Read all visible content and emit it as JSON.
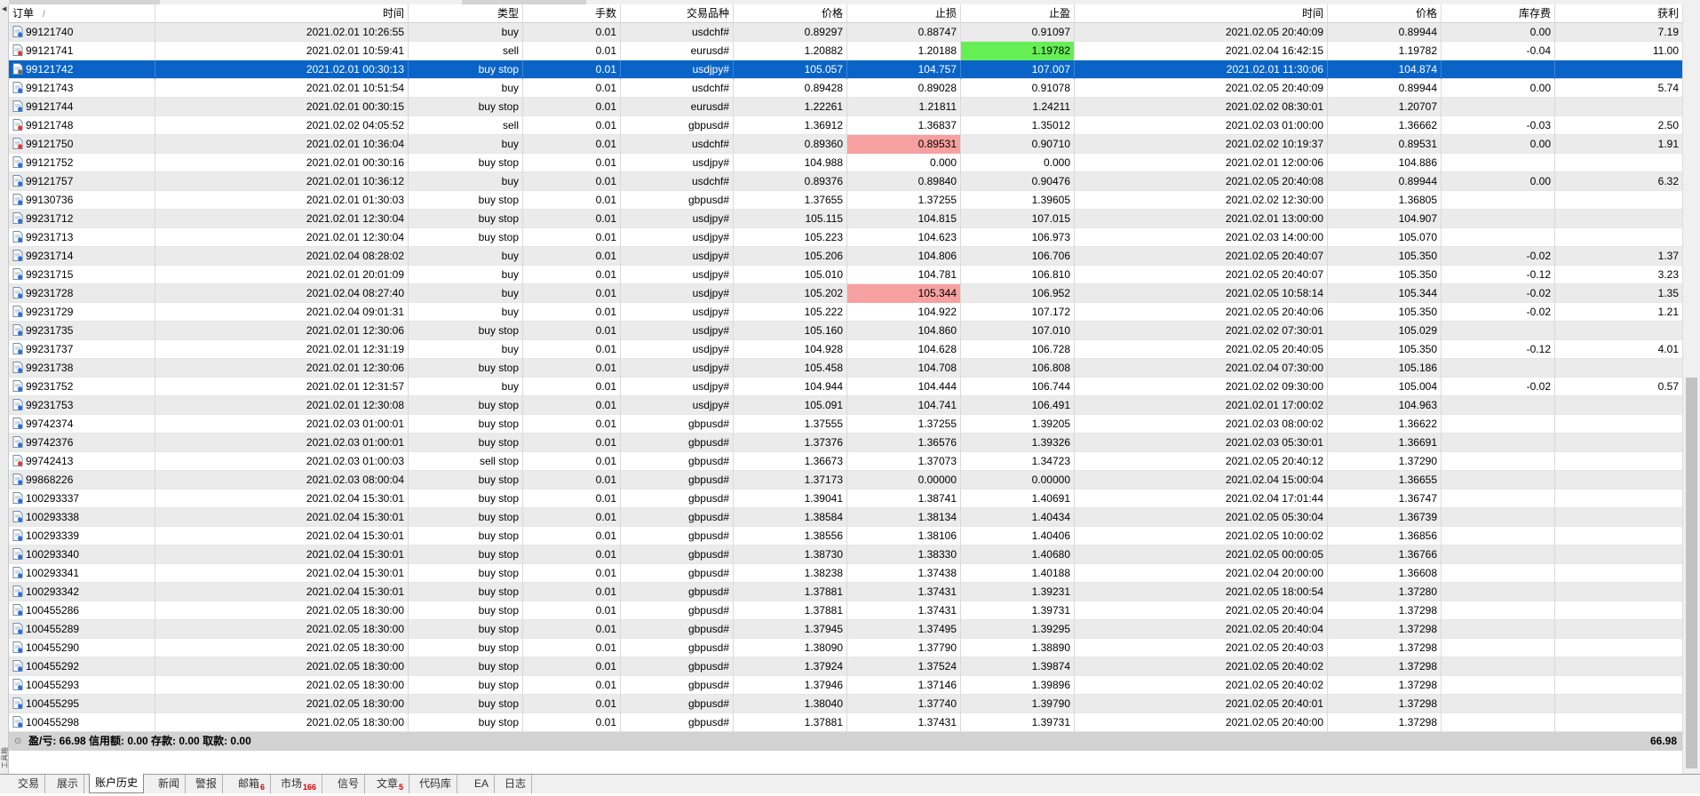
{
  "columns": [
    "订单",
    "时间",
    "类型",
    "手数",
    "交易品种",
    "价格",
    "止损",
    "止盈",
    "时间",
    "价格",
    "库存费",
    "获利"
  ],
  "sort_indicator": "/",
  "colors": {
    "selection": "#0a64c8",
    "tp_hit": "#66ee55",
    "sl_hit": "#f7a0a0",
    "tab_badge": "#d00000"
  },
  "rows": [
    {
      "icon": "buy",
      "order": "99121740",
      "open_time": "2021.02.01 10:26:55",
      "type": "buy",
      "volume": "0.01",
      "symbol": "usdchf#",
      "price": "0.89297",
      "sl": "0.88747",
      "tp": "0.91097",
      "close_time": "2021.02.05 20:40:09",
      "close_price": "0.89944",
      "swap": "0.00",
      "profit": "7.19"
    },
    {
      "icon": "sell",
      "order": "99121741",
      "open_time": "2021.02.01 10:59:41",
      "type": "sell",
      "volume": "0.01",
      "symbol": "eurusd#",
      "price": "1.20882",
      "sl": "1.20188",
      "tp": "1.19782",
      "tp_hl": "green",
      "close_time": "2021.02.04 16:42:15",
      "close_price": "1.19782",
      "swap": "-0.04",
      "profit": "11.00"
    },
    {
      "icon": "pending",
      "selected": true,
      "order": "99121742",
      "open_time": "2021.02.01 00:30:13",
      "type": "buy stop",
      "volume": "0.01",
      "symbol": "usdjpy#",
      "price": "105.057",
      "sl": "104.757",
      "tp": "107.007",
      "close_time": "2021.02.01 11:30:06",
      "close_price": "104.874",
      "swap": "",
      "profit": ""
    },
    {
      "icon": "buy",
      "order": "99121743",
      "open_time": "2021.02.01 10:51:54",
      "type": "buy",
      "volume": "0.01",
      "symbol": "usdchf#",
      "price": "0.89428",
      "sl": "0.89028",
      "tp": "0.91078",
      "close_time": "2021.02.05 20:40:09",
      "close_price": "0.89944",
      "swap": "0.00",
      "profit": "5.74"
    },
    {
      "icon": "buy",
      "order": "99121744",
      "open_time": "2021.02.01 00:30:15",
      "type": "buy stop",
      "volume": "0.01",
      "symbol": "eurusd#",
      "price": "1.22261",
      "sl": "1.21811",
      "tp": "1.24211",
      "close_time": "2021.02.02 08:30:01",
      "close_price": "1.20707",
      "swap": "",
      "profit": ""
    },
    {
      "icon": "sell",
      "order": "99121748",
      "open_time": "2021.02.02 04:05:52",
      "type": "sell",
      "volume": "0.01",
      "symbol": "gbpusd#",
      "price": "1.36912",
      "sl": "1.36837",
      "tp": "1.35012",
      "close_time": "2021.02.03 01:00:00",
      "close_price": "1.36662",
      "swap": "-0.03",
      "profit": "2.50"
    },
    {
      "icon": "sell",
      "order": "99121750",
      "open_time": "2021.02.01 10:36:04",
      "type": "buy",
      "volume": "0.01",
      "symbol": "usdchf#",
      "price": "0.89360",
      "sl": "0.89531",
      "sl_hl": "red",
      "tp": "0.90710",
      "close_time": "2021.02.02 10:19:37",
      "close_price": "0.89531",
      "swap": "0.00",
      "profit": "1.91"
    },
    {
      "icon": "buy",
      "order": "99121752",
      "open_time": "2021.02.01 00:30:16",
      "type": "buy stop",
      "volume": "0.01",
      "symbol": "usdjpy#",
      "price": "104.988",
      "sl": "0.000",
      "tp": "0.000",
      "close_time": "2021.02.01 12:00:06",
      "close_price": "104.886",
      "swap": "",
      "profit": ""
    },
    {
      "icon": "buy",
      "order": "99121757",
      "open_time": "2021.02.01 10:36:12",
      "type": "buy",
      "volume": "0.01",
      "symbol": "usdchf#",
      "price": "0.89376",
      "sl": "0.89840",
      "tp": "0.90476",
      "close_time": "2021.02.05 20:40:08",
      "close_price": "0.89944",
      "swap": "0.00",
      "profit": "6.32"
    },
    {
      "icon": "buy",
      "order": "99130736",
      "open_time": "2021.02.01 01:30:03",
      "type": "buy stop",
      "volume": "0.01",
      "symbol": "gbpusd#",
      "price": "1.37655",
      "sl": "1.37255",
      "tp": "1.39605",
      "close_time": "2021.02.02 12:30:00",
      "close_price": "1.36805",
      "swap": "",
      "profit": ""
    },
    {
      "icon": "buy",
      "order": "99231712",
      "open_time": "2021.02.01 12:30:04",
      "type": "buy stop",
      "volume": "0.01",
      "symbol": "usdjpy#",
      "price": "105.115",
      "sl": "104.815",
      "tp": "107.015",
      "close_time": "2021.02.01 13:00:00",
      "close_price": "104.907",
      "swap": "",
      "profit": ""
    },
    {
      "icon": "buy",
      "order": "99231713",
      "open_time": "2021.02.01 12:30:04",
      "type": "buy stop",
      "volume": "0.01",
      "symbol": "usdjpy#",
      "price": "105.223",
      "sl": "104.623",
      "tp": "106.973",
      "close_time": "2021.02.03 14:00:00",
      "close_price": "105.070",
      "swap": "",
      "profit": ""
    },
    {
      "icon": "buy",
      "order": "99231714",
      "open_time": "2021.02.04 08:28:02",
      "type": "buy",
      "volume": "0.01",
      "symbol": "usdjpy#",
      "price": "105.206",
      "sl": "104.806",
      "tp": "106.706",
      "close_time": "2021.02.05 20:40:07",
      "close_price": "105.350",
      "swap": "-0.02",
      "profit": "1.37"
    },
    {
      "icon": "buy",
      "order": "99231715",
      "open_time": "2021.02.01 20:01:09",
      "type": "buy",
      "volume": "0.01",
      "symbol": "usdjpy#",
      "price": "105.010",
      "sl": "104.781",
      "tp": "106.810",
      "close_time": "2021.02.05 20:40:07",
      "close_price": "105.350",
      "swap": "-0.12",
      "profit": "3.23"
    },
    {
      "icon": "buy",
      "order": "99231728",
      "open_time": "2021.02.04 08:27:40",
      "type": "buy",
      "volume": "0.01",
      "symbol": "usdjpy#",
      "price": "105.202",
      "sl": "105.344",
      "sl_hl": "red",
      "tp": "106.952",
      "close_time": "2021.02.05 10:58:14",
      "close_price": "105.344",
      "swap": "-0.02",
      "profit": "1.35"
    },
    {
      "icon": "buy",
      "order": "99231729",
      "open_time": "2021.02.04 09:01:31",
      "type": "buy",
      "volume": "0.01",
      "symbol": "usdjpy#",
      "price": "105.222",
      "sl": "104.922",
      "tp": "107.172",
      "close_time": "2021.02.05 20:40:06",
      "close_price": "105.350",
      "swap": "-0.02",
      "profit": "1.21"
    },
    {
      "icon": "buy",
      "order": "99231735",
      "open_time": "2021.02.01 12:30:06",
      "type": "buy stop",
      "volume": "0.01",
      "symbol": "usdjpy#",
      "price": "105.160",
      "sl": "104.860",
      "tp": "107.010",
      "close_time": "2021.02.02 07:30:01",
      "close_price": "105.029",
      "swap": "",
      "profit": ""
    },
    {
      "icon": "buy",
      "order": "99231737",
      "open_time": "2021.02.01 12:31:19",
      "type": "buy",
      "volume": "0.01",
      "symbol": "usdjpy#",
      "price": "104.928",
      "sl": "104.628",
      "tp": "106.728",
      "close_time": "2021.02.05 20:40:05",
      "close_price": "105.350",
      "swap": "-0.12",
      "profit": "4.01"
    },
    {
      "icon": "buy",
      "order": "99231738",
      "open_time": "2021.02.01 12:30:06",
      "type": "buy stop",
      "volume": "0.01",
      "symbol": "usdjpy#",
      "price": "105.458",
      "sl": "104.708",
      "tp": "106.808",
      "close_time": "2021.02.04 07:30:00",
      "close_price": "105.186",
      "swap": "",
      "profit": ""
    },
    {
      "icon": "buy",
      "order": "99231752",
      "open_time": "2021.02.01 12:31:57",
      "type": "buy",
      "volume": "0.01",
      "symbol": "usdjpy#",
      "price": "104.944",
      "sl": "104.444",
      "tp": "106.744",
      "close_time": "2021.02.02 09:30:00",
      "close_price": "105.004",
      "swap": "-0.02",
      "profit": "0.57"
    },
    {
      "icon": "buy",
      "order": "99231753",
      "open_time": "2021.02.01 12:30:08",
      "type": "buy stop",
      "volume": "0.01",
      "symbol": "usdjpy#",
      "price": "105.091",
      "sl": "104.741",
      "tp": "106.491",
      "close_time": "2021.02.01 17:00:02",
      "close_price": "104.963",
      "swap": "",
      "profit": ""
    },
    {
      "icon": "buy",
      "order": "99742374",
      "open_time": "2021.02.03 01:00:01",
      "type": "buy stop",
      "volume": "0.01",
      "symbol": "gbpusd#",
      "price": "1.37555",
      "sl": "1.37255",
      "tp": "1.39205",
      "close_time": "2021.02.03 08:00:02",
      "close_price": "1.36622",
      "swap": "",
      "profit": ""
    },
    {
      "icon": "buy",
      "order": "99742376",
      "open_time": "2021.02.03 01:00:01",
      "type": "buy stop",
      "volume": "0.01",
      "symbol": "gbpusd#",
      "price": "1.37376",
      "sl": "1.36576",
      "tp": "1.39326",
      "close_time": "2021.02.03 05:30:01",
      "close_price": "1.36691",
      "swap": "",
      "profit": ""
    },
    {
      "icon": "sell",
      "order": "99742413",
      "open_time": "2021.02.03 01:00:03",
      "type": "sell stop",
      "volume": "0.01",
      "symbol": "gbpusd#",
      "price": "1.36673",
      "sl": "1.37073",
      "tp": "1.34723",
      "close_time": "2021.02.05 20:40:12",
      "close_price": "1.37290",
      "swap": "",
      "profit": ""
    },
    {
      "icon": "buy",
      "order": "99868226",
      "open_time": "2021.02.03 08:00:04",
      "type": "buy stop",
      "volume": "0.01",
      "symbol": "gbpusd#",
      "price": "1.37173",
      "sl": "0.00000",
      "tp": "0.00000",
      "close_time": "2021.02.04 15:00:04",
      "close_price": "1.36655",
      "swap": "",
      "profit": ""
    },
    {
      "icon": "buy",
      "order": "100293337",
      "open_time": "2021.02.04 15:30:01",
      "type": "buy stop",
      "volume": "0.01",
      "symbol": "gbpusd#",
      "price": "1.39041",
      "sl": "1.38741",
      "tp": "1.40691",
      "close_time": "2021.02.04 17:01:44",
      "close_price": "1.36747",
      "swap": "",
      "profit": ""
    },
    {
      "icon": "buy",
      "order": "100293338",
      "open_time": "2021.02.04 15:30:01",
      "type": "buy stop",
      "volume": "0.01",
      "symbol": "gbpusd#",
      "price": "1.38584",
      "sl": "1.38134",
      "tp": "1.40434",
      "close_time": "2021.02.05 05:30:04",
      "close_price": "1.36739",
      "swap": "",
      "profit": ""
    },
    {
      "icon": "buy",
      "order": "100293339",
      "open_time": "2021.02.04 15:30:01",
      "type": "buy stop",
      "volume": "0.01",
      "symbol": "gbpusd#",
      "price": "1.38556",
      "sl": "1.38106",
      "tp": "1.40406",
      "close_time": "2021.02.05 10:00:02",
      "close_price": "1.36856",
      "swap": "",
      "profit": ""
    },
    {
      "icon": "buy",
      "order": "100293340",
      "open_time": "2021.02.04 15:30:01",
      "type": "buy stop",
      "volume": "0.01",
      "symbol": "gbpusd#",
      "price": "1.38730",
      "sl": "1.38330",
      "tp": "1.40680",
      "close_time": "2021.02.05 00:00:05",
      "close_price": "1.36766",
      "swap": "",
      "profit": ""
    },
    {
      "icon": "buy",
      "order": "100293341",
      "open_time": "2021.02.04 15:30:01",
      "type": "buy stop",
      "volume": "0.01",
      "symbol": "gbpusd#",
      "price": "1.38238",
      "sl": "1.37438",
      "tp": "1.40188",
      "close_time": "2021.02.04 20:00:00",
      "close_price": "1.36608",
      "swap": "",
      "profit": ""
    },
    {
      "icon": "buy",
      "order": "100293342",
      "open_time": "2021.02.04 15:30:01",
      "type": "buy stop",
      "volume": "0.01",
      "symbol": "gbpusd#",
      "price": "1.37881",
      "sl": "1.37431",
      "tp": "1.39231",
      "close_time": "2021.02.05 18:00:54",
      "close_price": "1.37280",
      "swap": "",
      "profit": ""
    },
    {
      "icon": "buy",
      "order": "100455286",
      "open_time": "2021.02.05 18:30:00",
      "type": "buy stop",
      "volume": "0.01",
      "symbol": "gbpusd#",
      "price": "1.37881",
      "sl": "1.37431",
      "tp": "1.39731",
      "close_time": "2021.02.05 20:40:04",
      "close_price": "1.37298",
      "swap": "",
      "profit": ""
    },
    {
      "icon": "buy",
      "order": "100455289",
      "open_time": "2021.02.05 18:30:00",
      "type": "buy stop",
      "volume": "0.01",
      "symbol": "gbpusd#",
      "price": "1.37945",
      "sl": "1.37495",
      "tp": "1.39295",
      "close_time": "2021.02.05 20:40:04",
      "close_price": "1.37298",
      "swap": "",
      "profit": ""
    },
    {
      "icon": "buy",
      "order": "100455290",
      "open_time": "2021.02.05 18:30:00",
      "type": "buy stop",
      "volume": "0.01",
      "symbol": "gbpusd#",
      "price": "1.38090",
      "sl": "1.37790",
      "tp": "1.38890",
      "close_time": "2021.02.05 20:40:03",
      "close_price": "1.37298",
      "swap": "",
      "profit": ""
    },
    {
      "icon": "buy",
      "order": "100455292",
      "open_time": "2021.02.05 18:30:00",
      "type": "buy stop",
      "volume": "0.01",
      "symbol": "gbpusd#",
      "price": "1.37924",
      "sl": "1.37524",
      "tp": "1.39874",
      "close_time": "2021.02.05 20:40:02",
      "close_price": "1.37298",
      "swap": "",
      "profit": ""
    },
    {
      "icon": "buy",
      "order": "100455293",
      "open_time": "2021.02.05 18:30:00",
      "type": "buy stop",
      "volume": "0.01",
      "symbol": "gbpusd#",
      "price": "1.37946",
      "sl": "1.37146",
      "tp": "1.39896",
      "close_time": "2021.02.05 20:40:02",
      "close_price": "1.37298",
      "swap": "",
      "profit": ""
    },
    {
      "icon": "buy",
      "order": "100455295",
      "open_time": "2021.02.05 18:30:00",
      "type": "buy stop",
      "volume": "0.01",
      "symbol": "gbpusd#",
      "price": "1.38040",
      "sl": "1.37740",
      "tp": "1.39790",
      "close_time": "2021.02.05 20:40:01",
      "close_price": "1.37298",
      "swap": "",
      "profit": ""
    },
    {
      "icon": "buy",
      "order": "100455298",
      "open_time": "2021.02.05 18:30:00",
      "type": "buy stop",
      "volume": "0.01",
      "symbol": "gbpusd#",
      "price": "1.37881",
      "sl": "1.37431",
      "tp": "1.39731",
      "close_time": "2021.02.05 20:40:00",
      "close_price": "1.37298",
      "swap": "",
      "profit": ""
    }
  ],
  "summary": {
    "icon": "circle-icon",
    "text": "盈/亏: 66.98  信用额: 0.00  存款: 0.00  取款: 0.00",
    "profit": "66.98"
  },
  "tabs": [
    {
      "label": "交易",
      "badge": ""
    },
    {
      "label": "展示",
      "badge": ""
    },
    {
      "label": "账户历史",
      "badge": "",
      "active": true
    },
    {
      "label": "新闻",
      "badge": ""
    },
    {
      "label": "警报",
      "badge": ""
    },
    {
      "label": "邮箱",
      "badge": "6"
    },
    {
      "label": "市场",
      "badge": "166"
    },
    {
      "label": "信号",
      "badge": ""
    },
    {
      "label": "文章",
      "badge": "5"
    },
    {
      "label": "代码库",
      "badge": ""
    },
    {
      "label": "EA",
      "badge": ""
    },
    {
      "label": "日志",
      "badge": ""
    }
  ],
  "side_label": "工具箱"
}
